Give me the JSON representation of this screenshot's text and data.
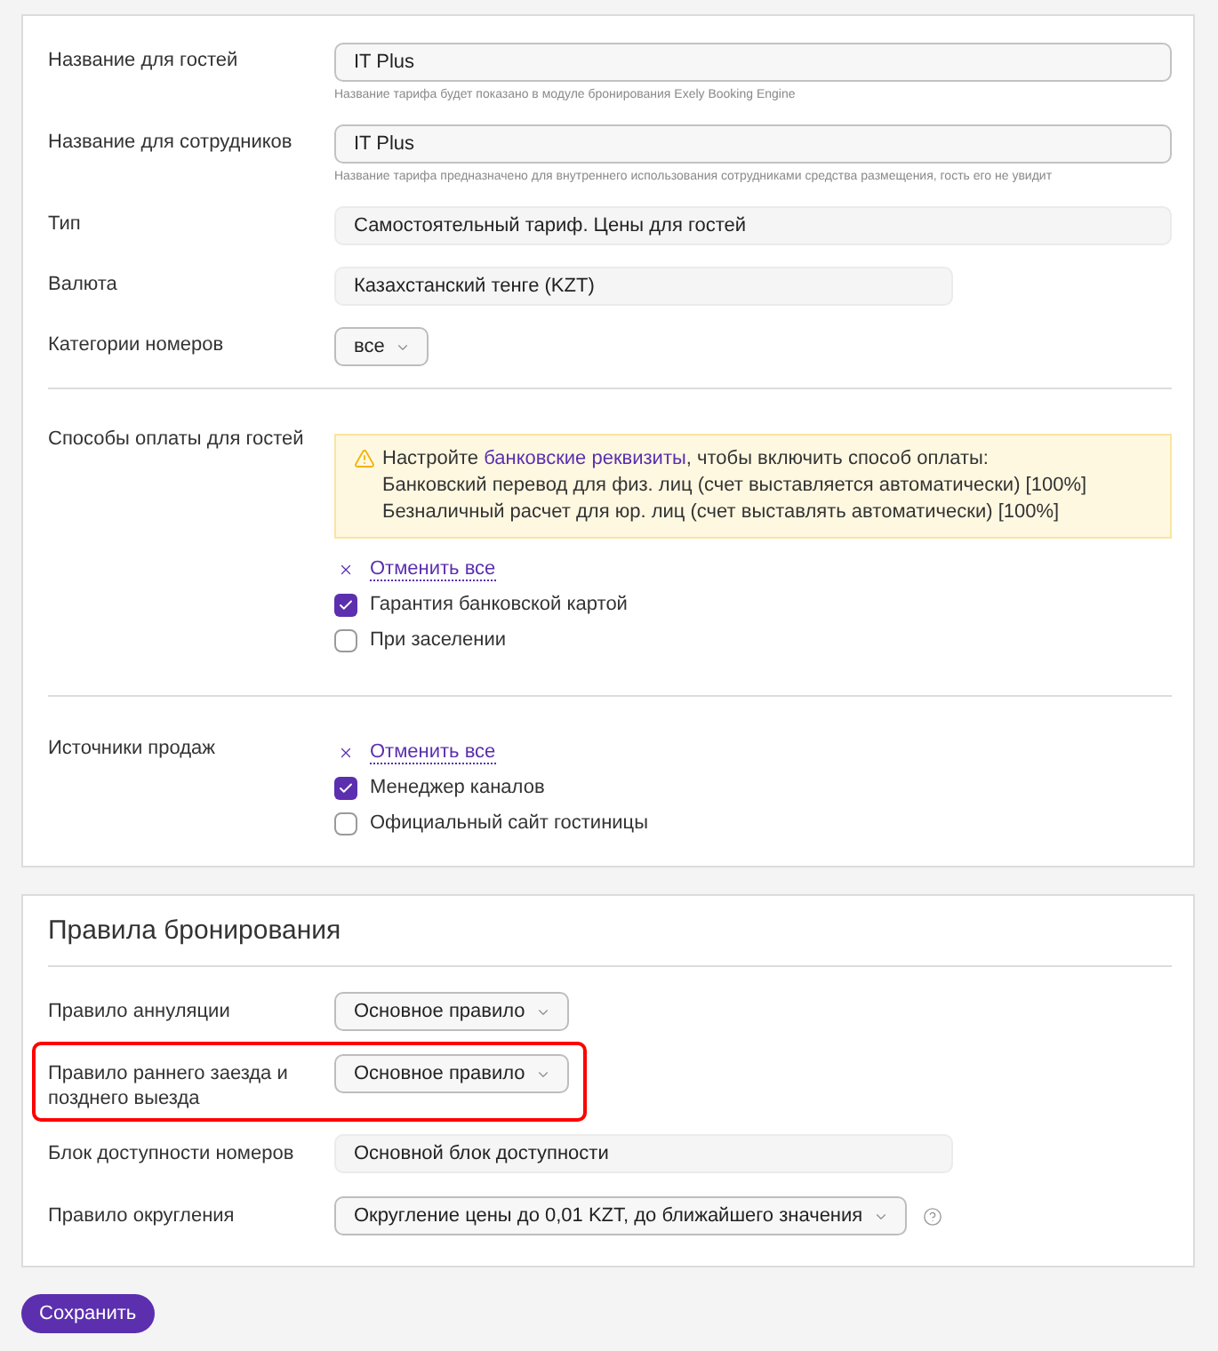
{
  "main_card": {
    "fields": [
      {
        "kind": "input",
        "label": "Название для гостей",
        "value": "IT Plus",
        "hint": "Название тарифа будет показано в модуле бронирования Exely Booking Engine"
      },
      {
        "kind": "input",
        "label": "Название для сотрудников",
        "value": "IT Plus",
        "hint": "Название тарифа предназначено для внутреннего использования сотрудниками средства размещения, гость его не увидит"
      },
      {
        "kind": "wide",
        "label": "Тип",
        "value": "Самостоятельный тариф. Цены для гостей"
      },
      {
        "kind": "readonly",
        "label": "Валюта",
        "value": "Казахстанский тенге (KZT)"
      },
      {
        "kind": "select",
        "label": "Категории номеров",
        "value": "все"
      }
    ],
    "payment_methods": {
      "label": "Способы оплаты для гостей",
      "alert": {
        "before_link": "Настройте ",
        "link": "банковские реквизиты",
        "after_link": ", чтобы включить способ оплаты:",
        "lines": [
          "Банковский перевод для физ. лиц (счет выставляется автоматически) [100%]",
          "Безналичный расчет для юр. лиц (счет выставлять автоматически) [100%]"
        ]
      },
      "clear_all": "Отменить все",
      "options": [
        {
          "label": "Гарантия банковской картой",
          "checked": true
        },
        {
          "label": "При заселении",
          "checked": false
        }
      ]
    },
    "sales_sources": {
      "label": "Источники продаж",
      "clear_all": "Отменить все",
      "options": [
        {
          "label": "Менеджер каналов",
          "checked": true
        },
        {
          "label": "Официальный сайт гостиницы",
          "checked": false
        }
      ]
    }
  },
  "booking_rules": {
    "title": "Правила бронирования",
    "rows": [
      {
        "kind": "select",
        "label": "Правило аннуляции",
        "value": "Основное правило",
        "highlighted": false,
        "help": false
      },
      {
        "kind": "select",
        "label": "Правило раннего заезда и позднего выезда",
        "value": "Основное правило",
        "highlighted": true,
        "help": false
      },
      {
        "kind": "readonly",
        "label": "Блок доступности номеров",
        "value": "Основной блок доступности",
        "highlighted": false,
        "help": false
      },
      {
        "kind": "select",
        "label": "Правило округления",
        "value": "Округление цены до 0,01 KZT, до ближайшего значения",
        "highlighted": false,
        "help": true
      }
    ]
  },
  "save_button": "Сохранить"
}
